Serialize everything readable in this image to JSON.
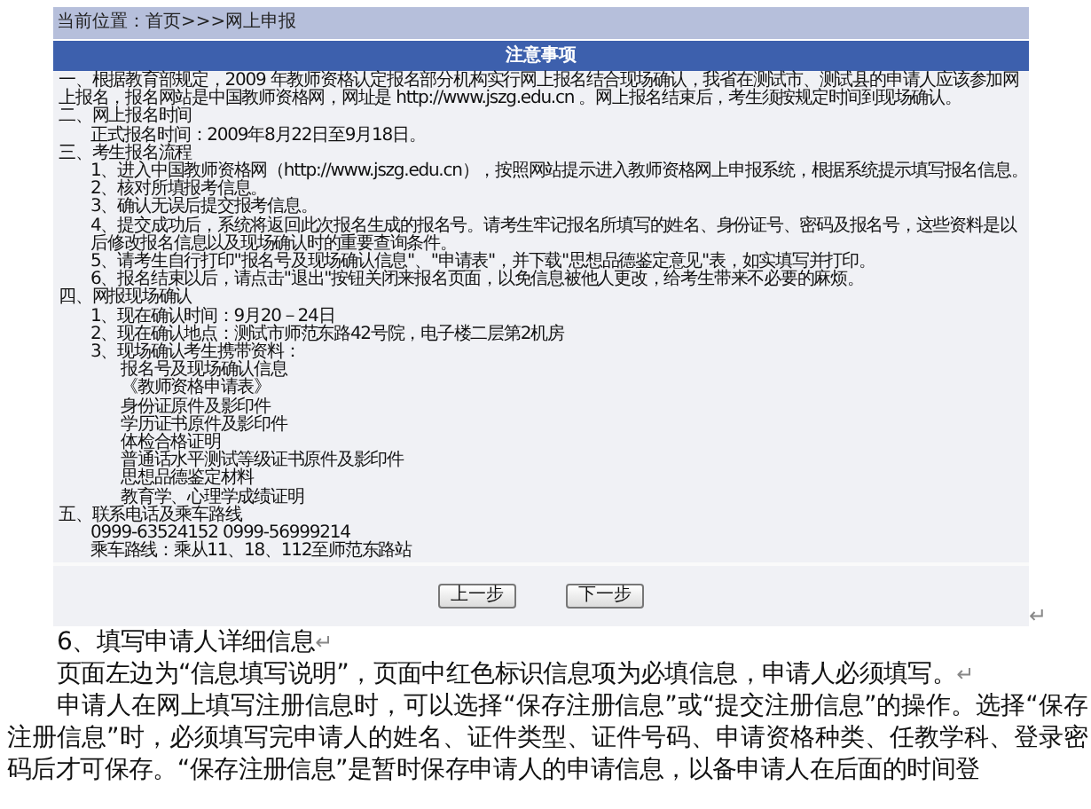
{
  "breadcrumb": "当前位置：首页>>>网上申报",
  "notice": {
    "title": "注意事项",
    "sections": [
      {
        "text": "一、根据教育部规定，2009 年教师资格认定报名部分机构实行网上报名结合现场确认，我省在测试市、测试县的申请人应该参加网上报名，报名网站是中国教师资格网，网址是 http://www.jszg.edu.cn  。网上报名结束后，考生须按规定时间到现场确认。"
      },
      {
        "text": "二、网上报名时间",
        "children": [
          {
            "text": "正式报名时间：2009年8月22日至9月18日。"
          }
        ]
      },
      {
        "text": "三、考生报名流程",
        "children": [
          {
            "text": "1、进入中国教师资格网（http://www.jszg.edu.cn），按照网站提示进入教师资格网上申报系统，根据系统提示填写报名信息。"
          },
          {
            "text": "2、核对所填报考信息。"
          },
          {
            "text": "3、确认无误后提交报考信息。"
          },
          {
            "text": "4、提交成功后，系统将返回此次报名生成的报名号。请考生牢记报名所填写的姓名、身份证号、密码及报名号，这些资料是以后修改报名信息以及现场确认时的重要查询条件。"
          },
          {
            "text": "5、请考生自行打印\"报名号及现场确认信息\"、\"申请表\"，并下载\"思想品德鉴定意见\"表，如实填写并打印。"
          },
          {
            "text": "6、报名结束以后，请点击\"退出\"按钮关闭来报名页面，以免信息被他人更改，给考生带来不必要的麻烦。"
          }
        ]
      },
      {
        "text": "四、网报现场确认",
        "children": [
          {
            "text": "1、现在确认时间：9月20－24日"
          },
          {
            "text": "2、现在确认地点：测试市师范东路42号院，电子楼二层第2机房"
          },
          {
            "text": "3、现场确认考生携带资料：",
            "children": [
              {
                "text": "报名号及现场确认信息"
              },
              {
                "text": "《教师资格申请表》"
              },
              {
                "text": "身份证原件及影印件"
              },
              {
                "text": "学历证书原件及影印件"
              },
              {
                "text": "体检合格证明"
              },
              {
                "text": "普通话水平测试等级证书原件及影印件"
              },
              {
                "text": "思想品德鉴定材料"
              },
              {
                "text": "教育学、心理学成绩证明"
              }
            ]
          }
        ]
      },
      {
        "text": "五、联系电话及乘车路线",
        "children": [
          {
            "text": "0999-63524152 0999-56999214"
          },
          {
            "text": "乘车路线：乘从11、18、112至师范东路站"
          }
        ]
      }
    ]
  },
  "buttons": [
    "上一步",
    "下一步"
  ],
  "panel_end_mark": "↵",
  "document": {
    "heading": "6、填写申请人详细信息",
    "heading_mark": "↵",
    "paragraphs": [
      {
        "text": "页面左边为“信息填写说明”，页面中红色标识信息项为必填信息，申请人必须填写。",
        "end_mark": "↵"
      },
      {
        "text": "申请人在网上填写注册信息时，可以选择“保存注册信息”或“提交注册信息”的操作。选择“保存注册信息”时，必须填写完申请人的姓名、证件类型、证件号码、申请资格种类、任教学科、登录密码后才可保存。“保存注册信息”是暂时保存申请人的申请信息，以备申请人在后面的时间登"
      }
    ]
  }
}
